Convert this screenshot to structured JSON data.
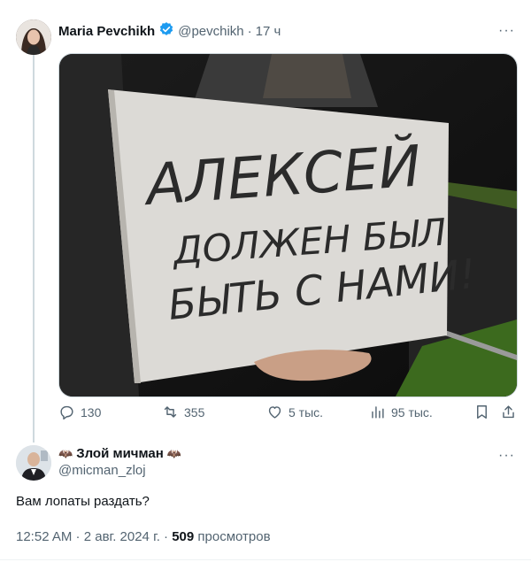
{
  "tweet": {
    "author": "Maria Pevchikh",
    "handle": "@pevchikh",
    "separator": "·",
    "time": "17 ч",
    "more": "···",
    "image_alt_sign": {
      "line1": "АЛЕКСЕЙ",
      "line2": "ДОЛЖЕН БЫЛ",
      "line3": "БЫТЬ С НАМИ!"
    },
    "actions": {
      "replies": "130",
      "retweets": "355",
      "likes": "5 тыс.",
      "views": "95 тыс."
    }
  },
  "reply": {
    "author": "Злой мичман",
    "author_emoji_left": "🦇",
    "author_emoji_right": "🦇",
    "handle": "@micman_zloj",
    "more": "···",
    "text": "Вам лопаты раздать?",
    "time": "12:52 AM",
    "sep1": " · ",
    "date": "2 авг. 2024 г.",
    "sep2": " · ",
    "views_count": "509",
    "views_label": "просмотров"
  },
  "colors": {
    "verified": "#1d9bf0",
    "muted": "#536471",
    "text": "#0f1419"
  }
}
